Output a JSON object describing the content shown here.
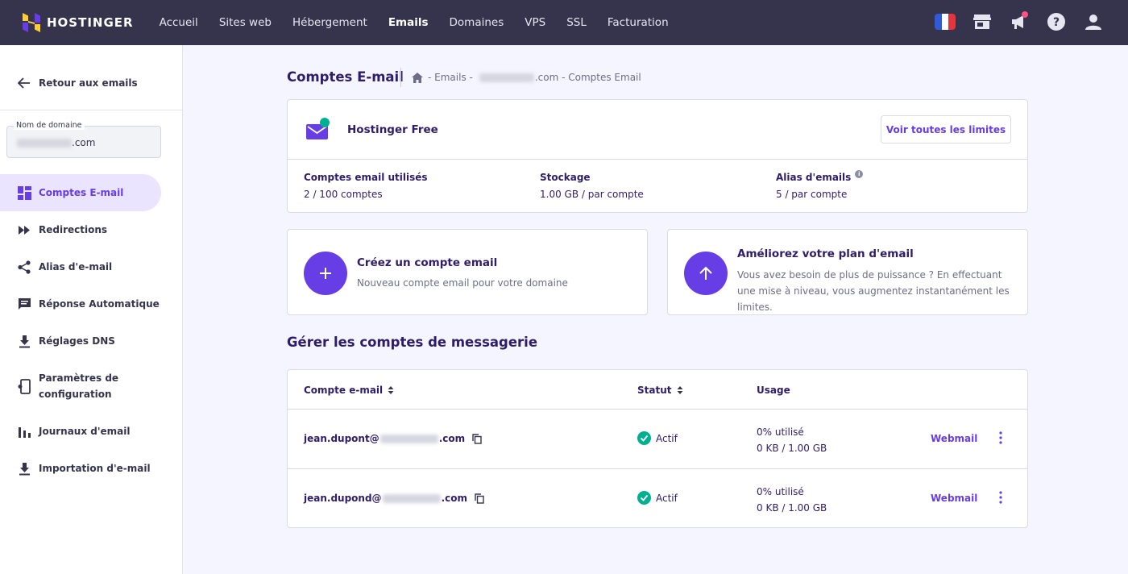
{
  "topbar": {
    "brand": "HOSTINGER",
    "nav": [
      "Accueil",
      "Sites web",
      "Hébergement",
      "Emails",
      "Domaines",
      "VPS",
      "SSL",
      "Facturation"
    ],
    "active_nav": "Emails",
    "icons": [
      "flag-fr-icon",
      "store-icon",
      "megaphone-icon",
      "help-icon",
      "user-icon"
    ]
  },
  "sidebar": {
    "back_label": "Retour aux emails",
    "domain_label": "Nom de domaine",
    "domain_suffix": ".com",
    "items": [
      {
        "label": "Comptes E-mail",
        "icon": "dashboard-icon"
      },
      {
        "label": "Redirections",
        "icon": "forward-icon"
      },
      {
        "label": "Alias d'e-mail",
        "icon": "share-icon"
      },
      {
        "label": "Réponse Automatique",
        "icon": "chat-icon"
      },
      {
        "label": "Réglages DNS",
        "icon": "download-icon"
      },
      {
        "label": "Paramètres de configuration",
        "icon": "device-settings-icon"
      },
      {
        "label": "Journaux d'email",
        "icon": "bar-chart-icon"
      },
      {
        "label": "Importation d'e-mail",
        "icon": "import-icon"
      }
    ],
    "active_index": 0
  },
  "header": {
    "title": "Comptes E-mail",
    "breadcrumb": {
      "part1": "- Emails -",
      "part2": ".com - Comptes Email"
    }
  },
  "plan": {
    "name": "Hostinger Free",
    "limits_button": "Voir toutes les limites",
    "stats": [
      {
        "key": "Comptes email utilisés",
        "value": "2 / 100 comptes"
      },
      {
        "key": "Stockage",
        "value": "1.00 GB / par compte"
      },
      {
        "key": "Alias d'emails",
        "value": "5 / par compte"
      }
    ]
  },
  "actions": {
    "create": {
      "title": "Créez un compte email",
      "desc": "Nouveau compte email pour votre domaine"
    },
    "upgrade": {
      "title": "Améliorez votre plan d'email",
      "desc": "Vous avez besoin de plus de puissance ? En effectuant une mise à niveau, vous augmentez instantanément les limites."
    }
  },
  "accounts": {
    "section_title": "Gérer les comptes de messagerie",
    "columns": [
      "Compte e-mail",
      "Statut",
      "Usage"
    ],
    "rows": [
      {
        "user": "jean.dupont@",
        "suffix": ".com",
        "status": "Actif",
        "usage_pct": "0% utilisé",
        "usage_size": "0 KB / 1.00 GB",
        "webmail": "Webmail"
      },
      {
        "user": "jean.dupond@",
        "suffix": ".com",
        "status": "Actif",
        "usage_pct": "0% utilisé",
        "usage_size": "0 KB / 1.00 GB",
        "webmail": "Webmail"
      }
    ]
  },
  "colors": {
    "accent": "#673de6",
    "topbar": "#36344d",
    "success": "#00b090",
    "background": "#f4f5ff"
  }
}
